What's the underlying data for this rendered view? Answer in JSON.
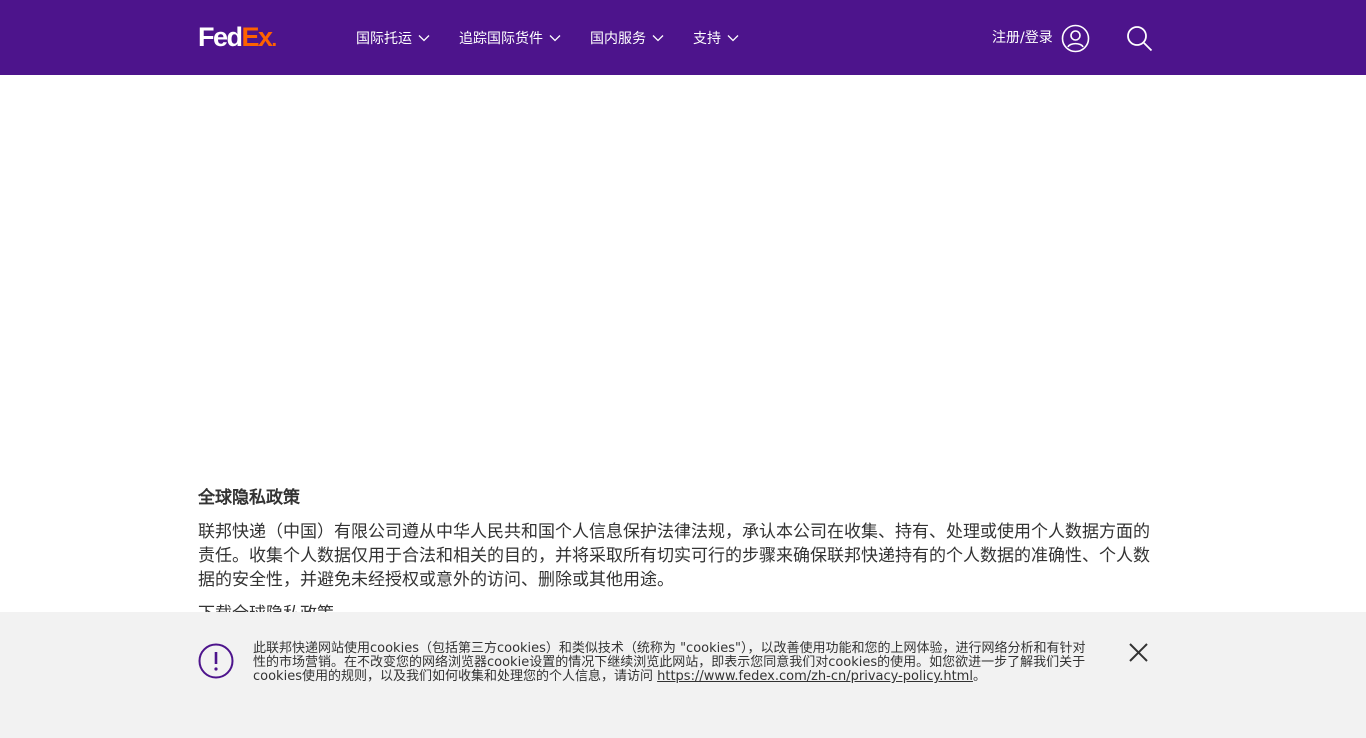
{
  "header": {
    "logo": {
      "fed": "Fed",
      "ex": "Ex",
      "dot": "."
    },
    "nav": [
      {
        "label": "国际托运"
      },
      {
        "label": "追踪国际货件"
      },
      {
        "label": "国内服务"
      },
      {
        "label": "支持"
      }
    ],
    "login_label": "注册/登录"
  },
  "content": {
    "title": "全球隐私政策",
    "body": "联邦快递（中国）有限公司遵从中华人民共和国个人信息保护法律法规，承认本公司在收集、持有、处理或使用个人数据方面的责任。收集个人数据仅用于合法和相关的目的，并将采取所有切实可行的步骤来确保联邦快递持有的个人数据的准确性、个人数据的安全性，并避免未经授权或意外的访问、删除或其他用途。",
    "download_label": "下载全球隐私政策"
  },
  "cookie_banner": {
    "text": "此联邦快递网站使用cookies（包括第三方cookies）和类似技术（统称为 \"cookies\"），以改善使用功能和您的上网体验，进行网络分析和有针对性的市场营销。在不改变您的网络浏览器cookie设置的情况下继续浏览此网站，即表示您同意我们对cookies的使用。如您欲进一步了解我们关于cookies使用的规则，以及我们如何收集和处理您的个人信息，请访问 ",
    "link_text": "https://www.fedex.com/zh-cn/privacy-policy.html",
    "suffix": "。"
  },
  "colors": {
    "brand_purple": "#4d148c",
    "brand_orange": "#ff6200",
    "banner_bg": "#f2f2f2"
  },
  "icons": [
    "chevron-down-icon",
    "user-icon",
    "search-icon",
    "alert-icon",
    "close-icon"
  ]
}
